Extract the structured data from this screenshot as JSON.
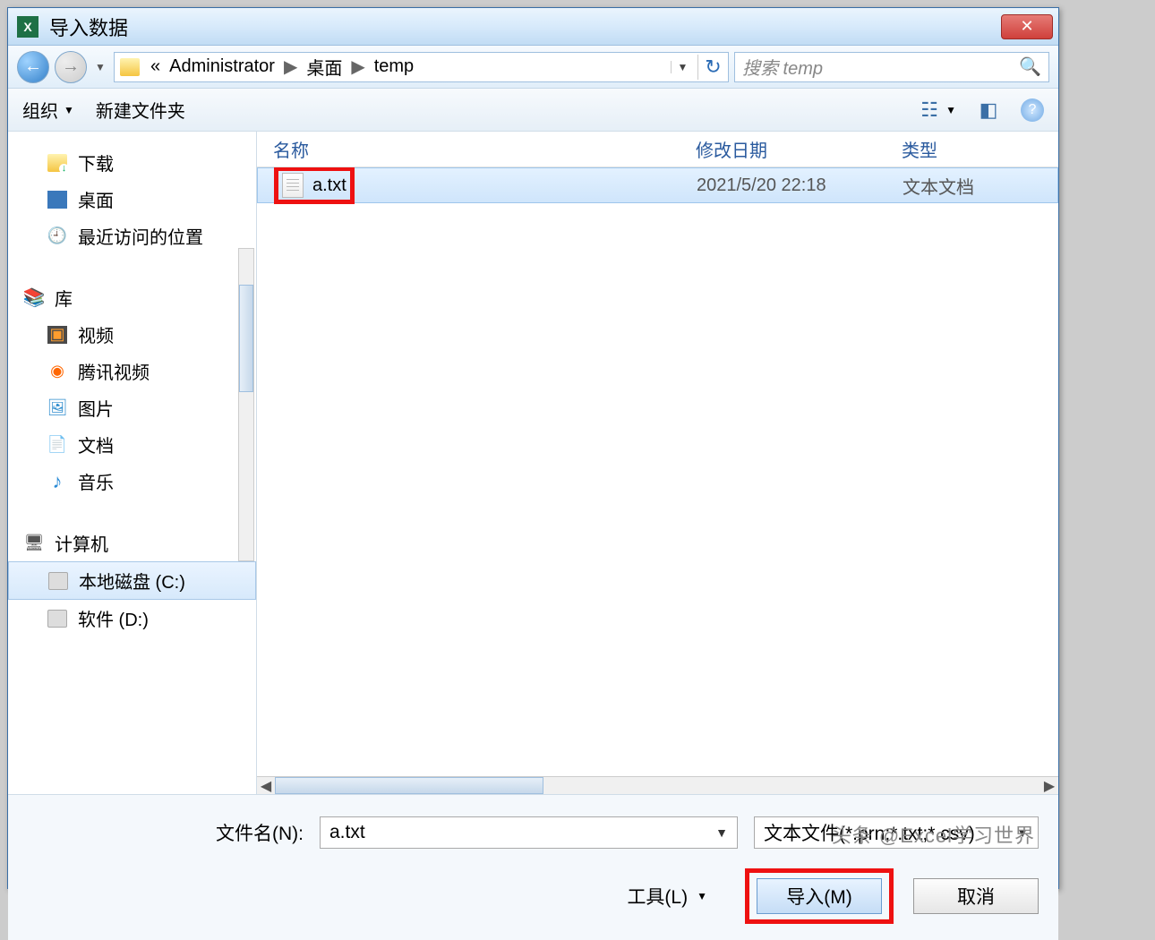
{
  "titlebar": {
    "title": "导入数据"
  },
  "address": {
    "chevron": "«",
    "items": [
      "Administrator",
      "桌面",
      "temp"
    ]
  },
  "search": {
    "placeholder": "搜索 temp"
  },
  "toolbar": {
    "organize": "组织",
    "newfolder": "新建文件夹"
  },
  "tree": {
    "downloads": "下载",
    "desktop": "桌面",
    "recent": "最近访问的位置",
    "libraries": "库",
    "videos": "视频",
    "tencent": "腾讯视频",
    "pictures": "图片",
    "documents": "文档",
    "music": "音乐",
    "computer": "计算机",
    "diskC": "本地磁盘 (C:)",
    "diskD": "软件 (D:)"
  },
  "columns": {
    "name": "名称",
    "date": "修改日期",
    "type": "类型"
  },
  "files": [
    {
      "name": "a.txt",
      "date": "2021/5/20 22:18",
      "type": "文本文档"
    }
  ],
  "footer": {
    "filename_label": "文件名(N):",
    "filename_value": "a.txt",
    "filetype": "文本文件(*.prn;*.txt;*.csv)",
    "tools": "工具(L)",
    "import": "导入(M)",
    "cancel": "取消"
  },
  "watermark": "头条 @Excel学习世界"
}
